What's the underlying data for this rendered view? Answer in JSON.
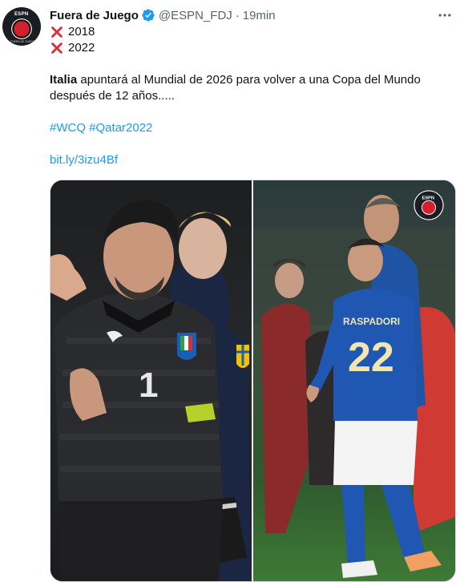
{
  "tweet": {
    "author_name": "Fuera de Juego",
    "handle": "@ESPN_FDJ",
    "separator": "·",
    "time": "19min",
    "lines": {
      "year1": "2018",
      "year2": "2022",
      "para_bold": "Italia",
      "para_rest_1": " apuntará al Mundial de 2026 para volver a una Copa del Mundo",
      "para_rest_2": "después de 12 años.....",
      "hashtag1": "#WCQ",
      "hashtag2": "#Qatar2022",
      "short_link": "bit.ly/3izu4Bf"
    },
    "avatar_logo": {
      "brand": "ESPN",
      "sub": "FUERA DE JUEGO"
    },
    "media": {
      "left_shirt_number": "1",
      "right_shirt_name": "RASPADORI",
      "right_shirt_number": "22",
      "watermark": "ESPN"
    },
    "icons": {
      "verified": "verified-badge-icon",
      "more": "more-options-icon",
      "cross": "cross-mark-icon"
    },
    "colors": {
      "link": "#1d9bf0",
      "verified": "#1d9bf0",
      "cross": "#d6303a",
      "muted": "#536471"
    }
  }
}
